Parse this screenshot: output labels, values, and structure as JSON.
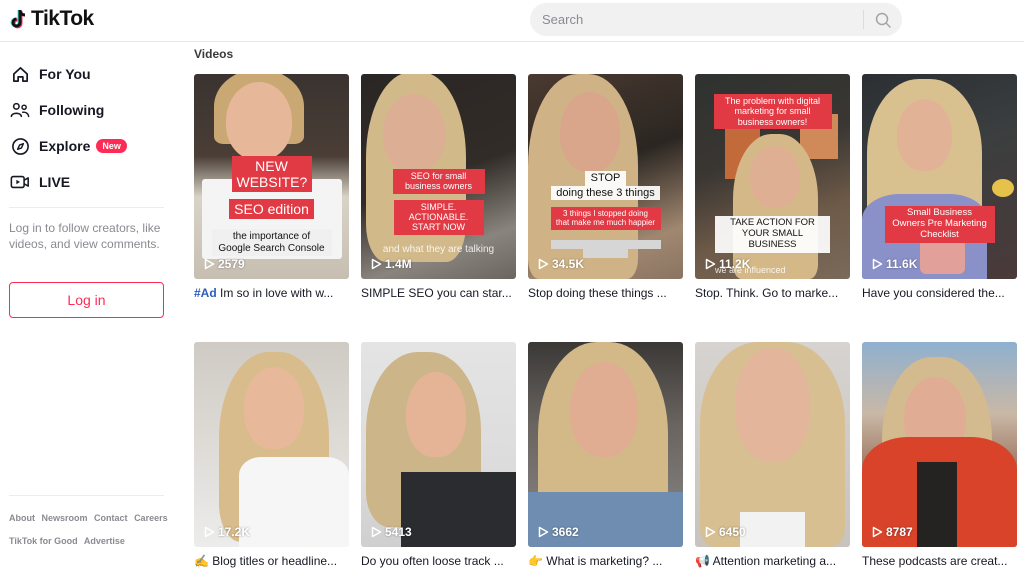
{
  "header": {
    "logo_text": "TikTok",
    "search_placeholder": "Search"
  },
  "sidebar": {
    "nav": [
      {
        "label": "For You",
        "icon": "home-icon"
      },
      {
        "label": "Following",
        "icon": "users-icon"
      },
      {
        "label": "Explore",
        "icon": "compass-icon",
        "badge": "New"
      },
      {
        "label": "LIVE",
        "icon": "live-video-icon"
      }
    ],
    "login_hint": "Log in to follow creators, like videos, and view comments.",
    "login_button": "Log in",
    "footer_links_row1": [
      "About",
      "Newsroom",
      "Contact",
      "Careers"
    ],
    "footer_links_row2": [
      "TikTok for Good",
      "Advertise"
    ]
  },
  "main": {
    "section_title": "Videos",
    "videos": [
      {
        "views": "2579",
        "caption_tag": "#Ad",
        "caption": " Im so in love with w...",
        "overlays": [
          "NEW WEBSITE?",
          "SEO edition",
          "the importance of Google Search Console"
        ]
      },
      {
        "views": "1.4M",
        "caption": "SIMPLE SEO you can star...",
        "overlays": [
          "SEO for small business owners",
          "SIMPLE. ACTIONABLE. START NOW",
          "and what they are talking"
        ]
      },
      {
        "views": "34.5K",
        "caption": "Stop doing these things ...",
        "overlays": [
          "STOP",
          "doing these 3 things",
          "3 things I stopped doing that make me much happier"
        ]
      },
      {
        "views": "11.2K",
        "caption": "Stop. Think. Go to marke...",
        "overlays": [
          "The problem with digital marketing for small business owners!",
          "TAKE ACTION FOR YOUR SMALL BUSINESS",
          "we are influenced"
        ]
      },
      {
        "views": "11.6K",
        "caption": "Have you considered the...",
        "overlays": [
          "Small Business Owners Pre Marketing Checklist"
        ]
      },
      {
        "views": "17.2K",
        "caption_emoji": "✍",
        "caption": "Blog titles or headline..."
      },
      {
        "views": "5413",
        "caption": "Do you often loose track ..."
      },
      {
        "views": "3662",
        "caption_emoji": "👉",
        "caption": "What is marketing? ..."
      },
      {
        "views": "6450",
        "caption_emoji": "📢",
        "caption": "Attention marketing a..."
      },
      {
        "views": "8787",
        "caption": "These podcasts are creat..."
      }
    ]
  },
  "colors": {
    "brand_red": "#fe2c55",
    "hashtag_blue": "#2b5db9",
    "overlay_red": "#e23a44"
  }
}
